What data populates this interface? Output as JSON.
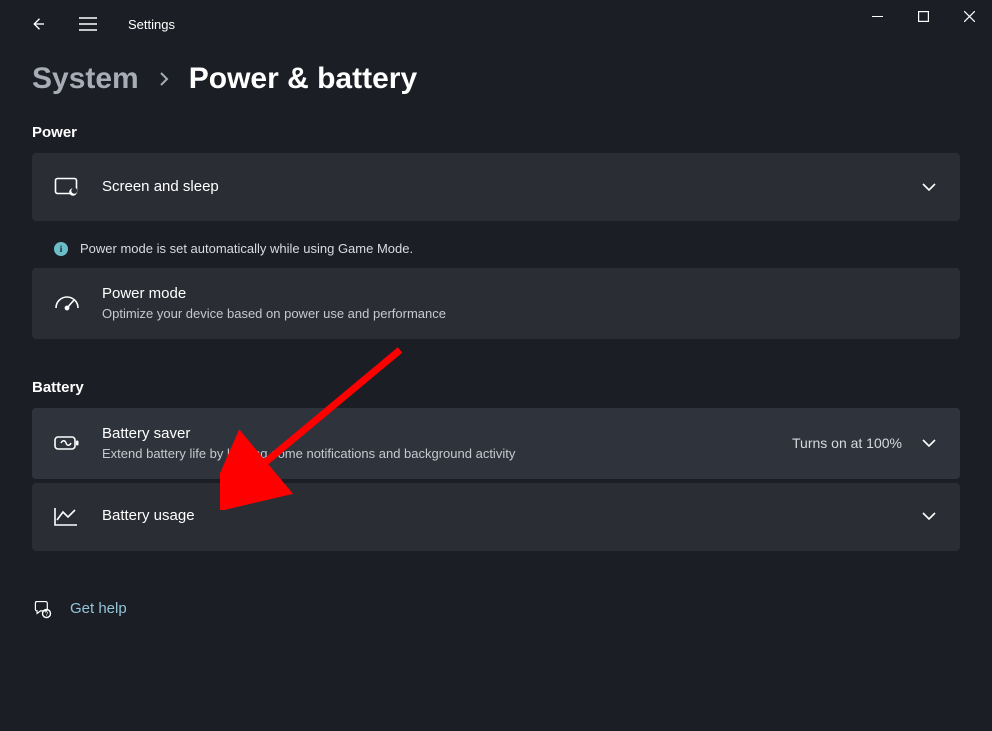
{
  "app_title": "Settings",
  "breadcrumb": {
    "parent": "System",
    "current": "Power & battery"
  },
  "sections": {
    "power": {
      "heading": "Power",
      "screen_sleep": {
        "title": "Screen and sleep"
      },
      "info_text": "Power mode is set automatically while using Game Mode.",
      "power_mode": {
        "title": "Power mode",
        "subtitle": "Optimize your device based on power use and performance"
      }
    },
    "battery": {
      "heading": "Battery",
      "battery_saver": {
        "title": "Battery saver",
        "subtitle": "Extend battery life by limiting some notifications and background activity",
        "value": "Turns on at 100%"
      },
      "battery_usage": {
        "title": "Battery usage"
      }
    }
  },
  "help_link": "Get help"
}
